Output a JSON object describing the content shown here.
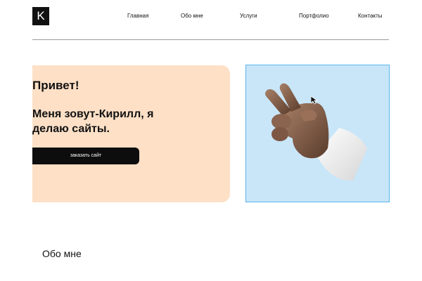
{
  "header": {
    "logo_letter": "K",
    "nav": [
      {
        "label": "Главная"
      },
      {
        "label": "Обо мне"
      },
      {
        "label": "Услуги"
      },
      {
        "label": "Портфолио"
      },
      {
        "label": "Контакты"
      }
    ]
  },
  "hero": {
    "greeting": "Привет!",
    "intro": "Меня зовут-Кирилл, я делаю сайты.",
    "button_label": "заказать сайт",
    "image_icon": "peace-sign-hand-icon"
  },
  "about": {
    "title": "Обо мне"
  },
  "colors": {
    "hero_card_bg": "#fde0c6",
    "image_card_bg": "#c9e6f9",
    "image_card_border": "#5ab4ea",
    "button_bg": "#0d0d0d"
  }
}
